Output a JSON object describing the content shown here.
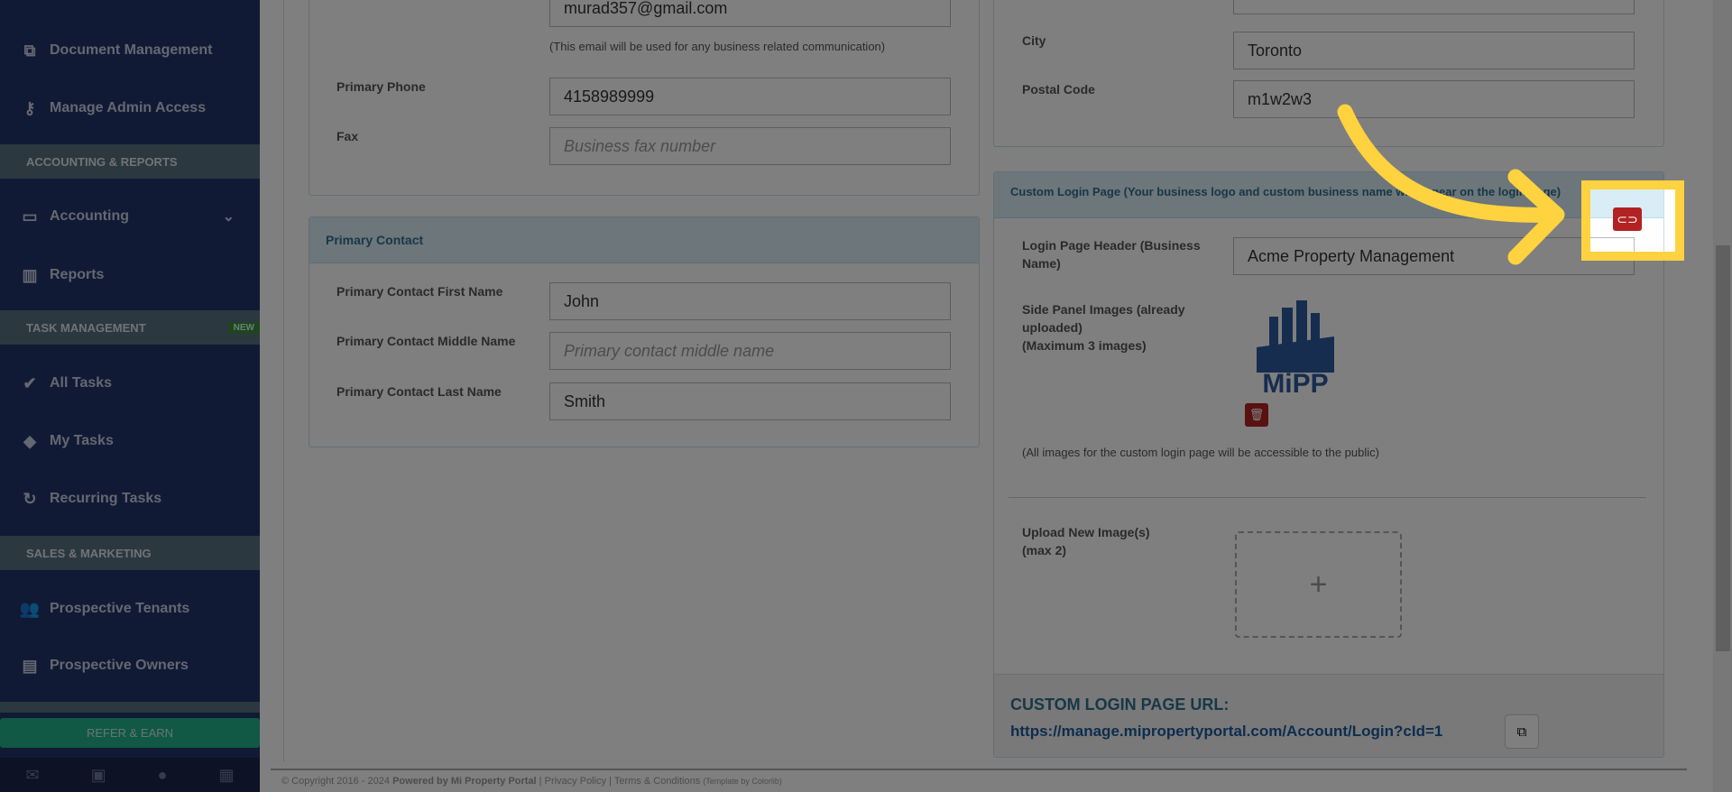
{
  "sidebar": {
    "items": [
      {
        "label": "Document Management",
        "icon": "documents-icon"
      },
      {
        "label": "Manage Admin Access",
        "icon": "key-icon"
      },
      {
        "label": "Accounting",
        "icon": "money-icon"
      },
      {
        "label": "Reports",
        "icon": "bar-chart-icon"
      },
      {
        "label": "All Tasks",
        "icon": "check-icon"
      },
      {
        "label": "My Tasks",
        "icon": "tag-icon"
      },
      {
        "label": "Recurring Tasks",
        "icon": "refresh-icon"
      },
      {
        "label": "Prospective Tenants",
        "icon": "users-icon"
      },
      {
        "label": "Prospective Owners",
        "icon": "id-card-icon"
      }
    ],
    "sections": [
      "ACCOUNTING & REPORTS",
      "TASK MANAGEMENT",
      "SALES & MARKETING"
    ],
    "new_badge": "NEW",
    "refer": "REFER & EARN"
  },
  "business": {
    "email_value": "murad357@gmail.com",
    "email_note": "(This email will be used for any business related communication)",
    "phone_label": "Primary Phone",
    "phone_value": "4158989999",
    "fax_label": "Fax",
    "fax_placeholder": "Business fax number"
  },
  "contact": {
    "title": "Primary Contact",
    "first_label": "Primary Contact First Name",
    "first_value": "John",
    "middle_label": "Primary Contact Middle Name",
    "middle_placeholder": "Primary contact middle name",
    "last_label": "Primary Contact Last Name",
    "last_value": "Smith"
  },
  "address": {
    "city_label": "City",
    "city_value": "Toronto",
    "postal_label": "Postal Code",
    "postal_value": "m1w2w3"
  },
  "login": {
    "title": "Custom Login Page (Your business logo and custom business name will appear on the login page)",
    "header_label": "Login Page Header (Business Name)",
    "header_value": "Acme Property Management",
    "images_label": "Side Panel Images (already uploaded)",
    "images_max": "(Maximum 3 images)",
    "logo_text": "MiPP",
    "public_note": "(All images for the custom login page will be accessible to the public)",
    "upload_label": "Upload New Image(s)",
    "upload_max": "(max 2)",
    "url_title": "CUSTOM LOGIN PAGE URL:",
    "url": "https://manage.mipropertyportal.com/Account/Login?cId=1"
  },
  "footer": {
    "copyright": "© Copyright 2016 - 2024",
    "powered": "Powered by Mi Property Portal",
    "privacy": "Privacy Policy",
    "terms": "Terms & Conditions",
    "template": "(Template by Colorlib)"
  },
  "colors": {
    "highlight": "#ffd23f",
    "toggle": "#b32222"
  }
}
